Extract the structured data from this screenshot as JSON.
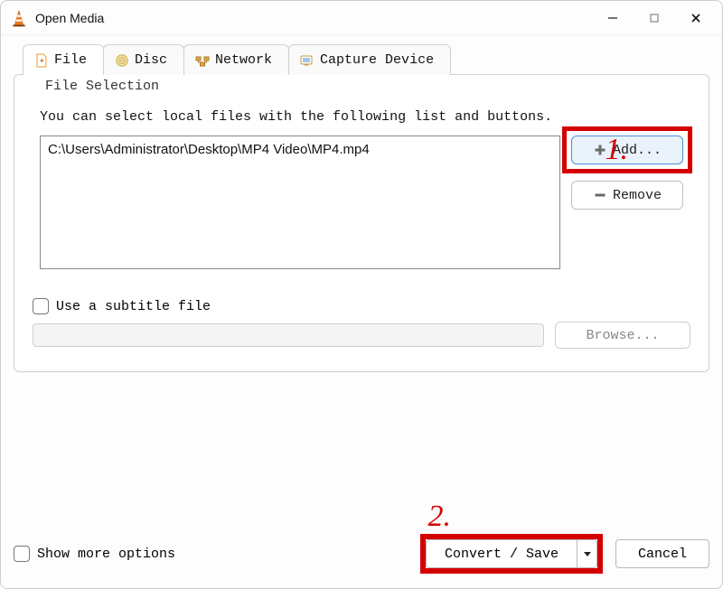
{
  "window": {
    "title": "Open Media"
  },
  "tabs": {
    "file": "File",
    "disc": "Disc",
    "network": "Network",
    "capture": "Capture Device"
  },
  "file_selection": {
    "legend": "File Selection",
    "help": "You can select local files with the following list and buttons.",
    "entries": [
      "C:\\Users\\Administrator\\Desktop\\MP4 Video\\MP4.mp4"
    ],
    "add_label": "Add...",
    "remove_label": "Remove"
  },
  "subtitle": {
    "checkbox_label": "Use a subtitle file",
    "browse_label": "Browse..."
  },
  "footer": {
    "show_more_label": "Show more options",
    "convert_label": "Convert / Save",
    "cancel_label": "Cancel"
  },
  "annotations": {
    "one": "1.",
    "two": "2."
  }
}
